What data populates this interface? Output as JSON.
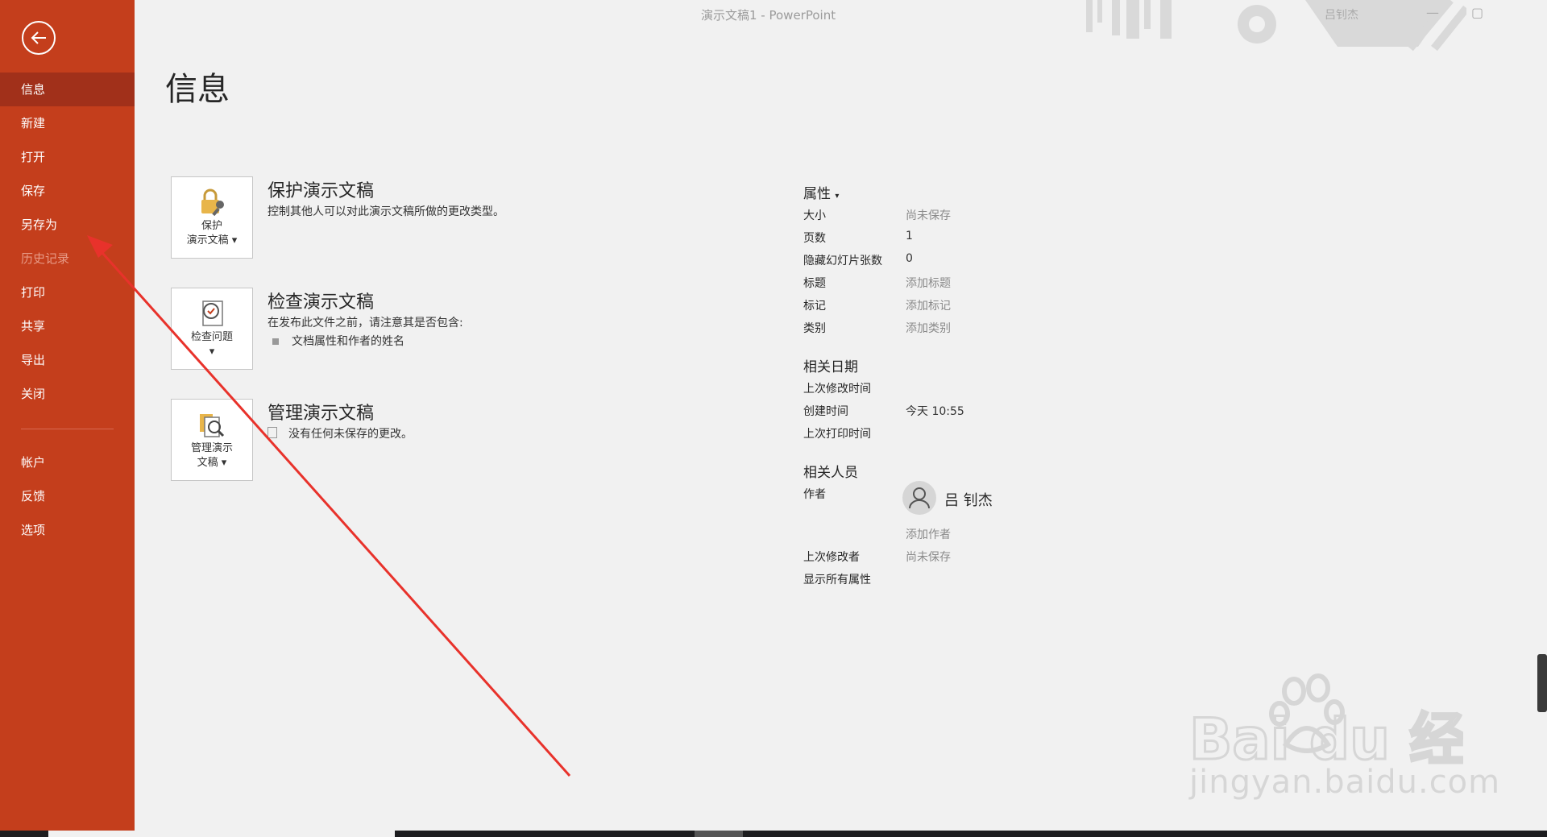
{
  "window": {
    "title": "演示文稿1 - PowerPoint",
    "user": "吕钊杰"
  },
  "sidebar": {
    "items": [
      {
        "label": "信息",
        "state": "active"
      },
      {
        "label": "新建"
      },
      {
        "label": "打开"
      },
      {
        "label": "保存"
      },
      {
        "label": "另存为"
      },
      {
        "label": "历史记录",
        "state": "disabled"
      },
      {
        "label": "打印"
      },
      {
        "label": "共享"
      },
      {
        "label": "导出"
      },
      {
        "label": "关闭"
      }
    ],
    "bottom_items": [
      {
        "label": "帐户"
      },
      {
        "label": "反馈"
      },
      {
        "label": "选项"
      }
    ]
  },
  "page": {
    "title": "信息"
  },
  "cards": {
    "protect": {
      "button_line1": "保护",
      "button_line2": "演示文稿",
      "title": "保护演示文稿",
      "desc": "控制其他人可以对此演示文稿所做的更改类型。"
    },
    "inspect": {
      "button_line1": "检查问题",
      "title": "检查演示文稿",
      "desc": "在发布此文件之前，请注意其是否包含:",
      "bullet": "文档属性和作者的姓名"
    },
    "manage": {
      "button_line1": "管理演示",
      "button_line2": "文稿",
      "title": "管理演示文稿",
      "desc": "没有任何未保存的更改。"
    }
  },
  "properties": {
    "title": "属性",
    "rows": [
      {
        "key": "大小",
        "value": "尚未保存"
      },
      {
        "key": "页数",
        "value": "1"
      },
      {
        "key": "隐藏幻灯片张数",
        "value": "0"
      },
      {
        "key": "标题",
        "value": "添加标题"
      },
      {
        "key": "标记",
        "value": "添加标记"
      },
      {
        "key": "类别",
        "value": "添加类别"
      }
    ]
  },
  "dates": {
    "title": "相关日期",
    "rows": [
      {
        "key": "上次修改时间",
        "value": ""
      },
      {
        "key": "创建时间",
        "value": "今天 10:55"
      },
      {
        "key": "上次打印时间",
        "value": ""
      }
    ]
  },
  "people": {
    "title": "相关人员",
    "author_label": "作者",
    "author_name": "吕 钊杰",
    "add_author": "添加作者",
    "last_modified_by_label": "上次修改者",
    "last_modified_by_value": "尚未保存",
    "show_all": "显示所有属性"
  },
  "watermark": {
    "brand": "Bai du 经验",
    "url": "jingyan.baidu.com"
  },
  "colors": {
    "sidebar": "#c43e1c",
    "sidebar_active": "#a1301a",
    "link": "#2b579a",
    "annotation_arrow": "#e8322b"
  }
}
